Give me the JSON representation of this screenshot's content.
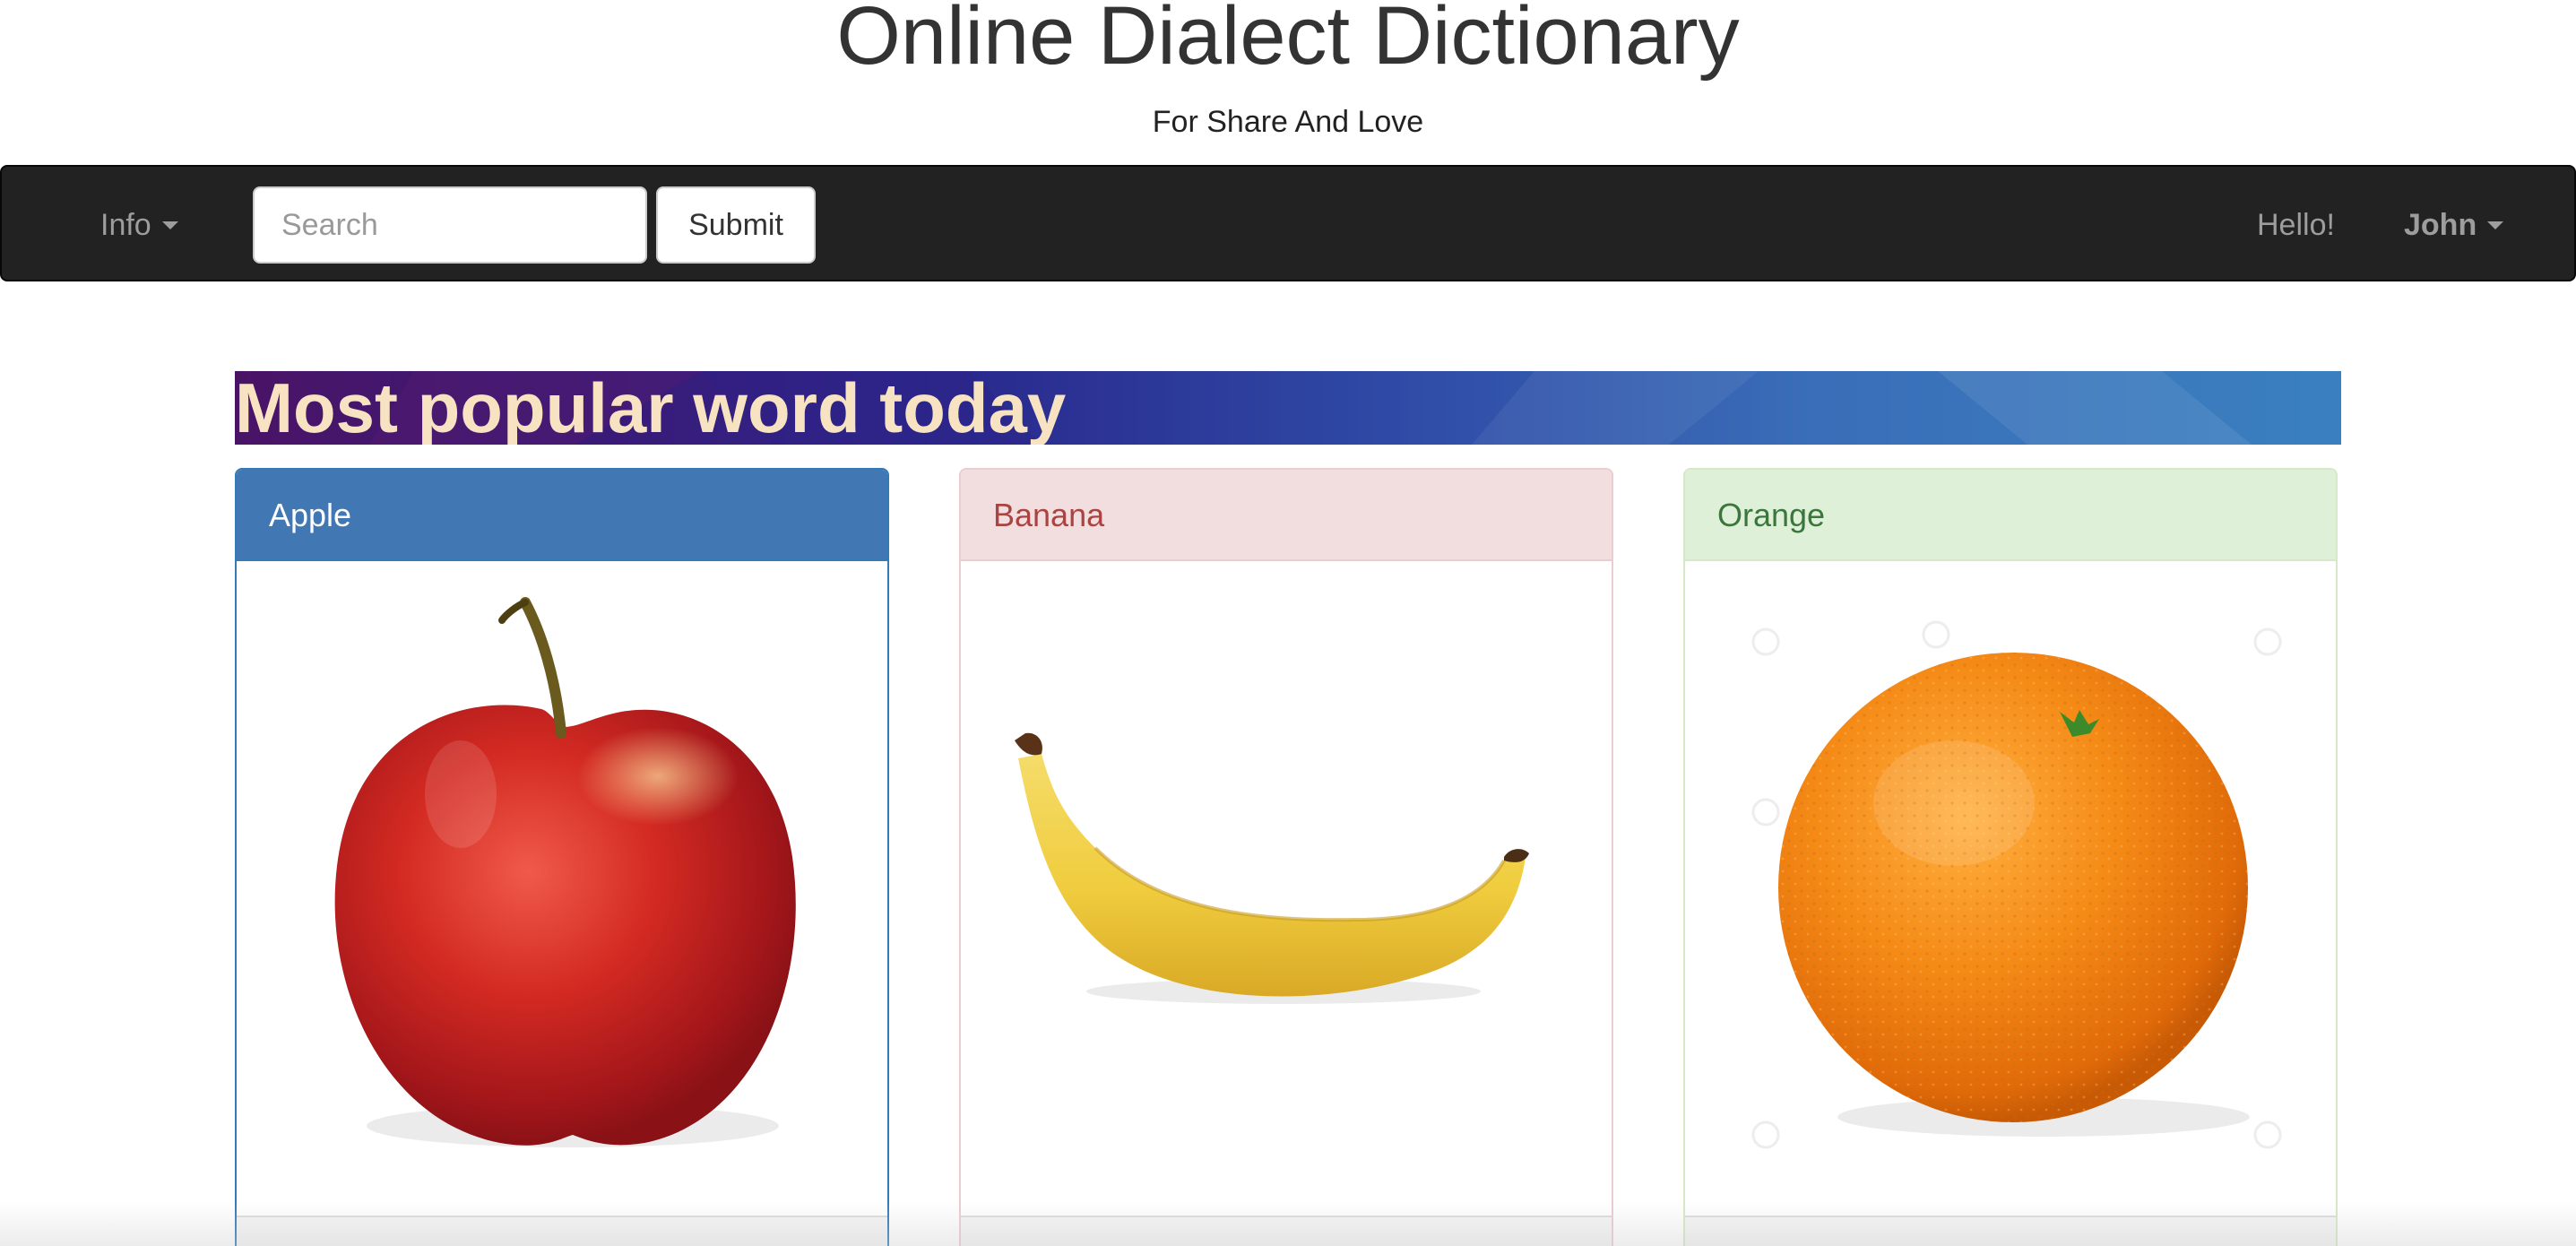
{
  "header": {
    "title": "Online Dialect Dictionary",
    "subtitle": "For Share And Love"
  },
  "navbar": {
    "info_label": "Info",
    "search_placeholder": "Search",
    "search_value": "",
    "submit_label": "Submit",
    "greeting": "Hello!",
    "user_name": "John"
  },
  "banner": {
    "title": "Most popular word today"
  },
  "panels": [
    {
      "title": "Apple",
      "style": "primary",
      "image": "apple-image"
    },
    {
      "title": "Banana",
      "style": "danger",
      "image": "banana-image"
    },
    {
      "title": "Orange",
      "style": "success",
      "image": "orange-image"
    }
  ],
  "colors": {
    "navbar_bg": "#222222",
    "nav_text": "#9d9d9d",
    "banner_text": "#f7e3c2",
    "primary": "#337ab7",
    "danger_bg": "#f2dede",
    "danger_text": "#a94442",
    "success_bg": "#dff0d8",
    "success_text": "#3c763d"
  }
}
